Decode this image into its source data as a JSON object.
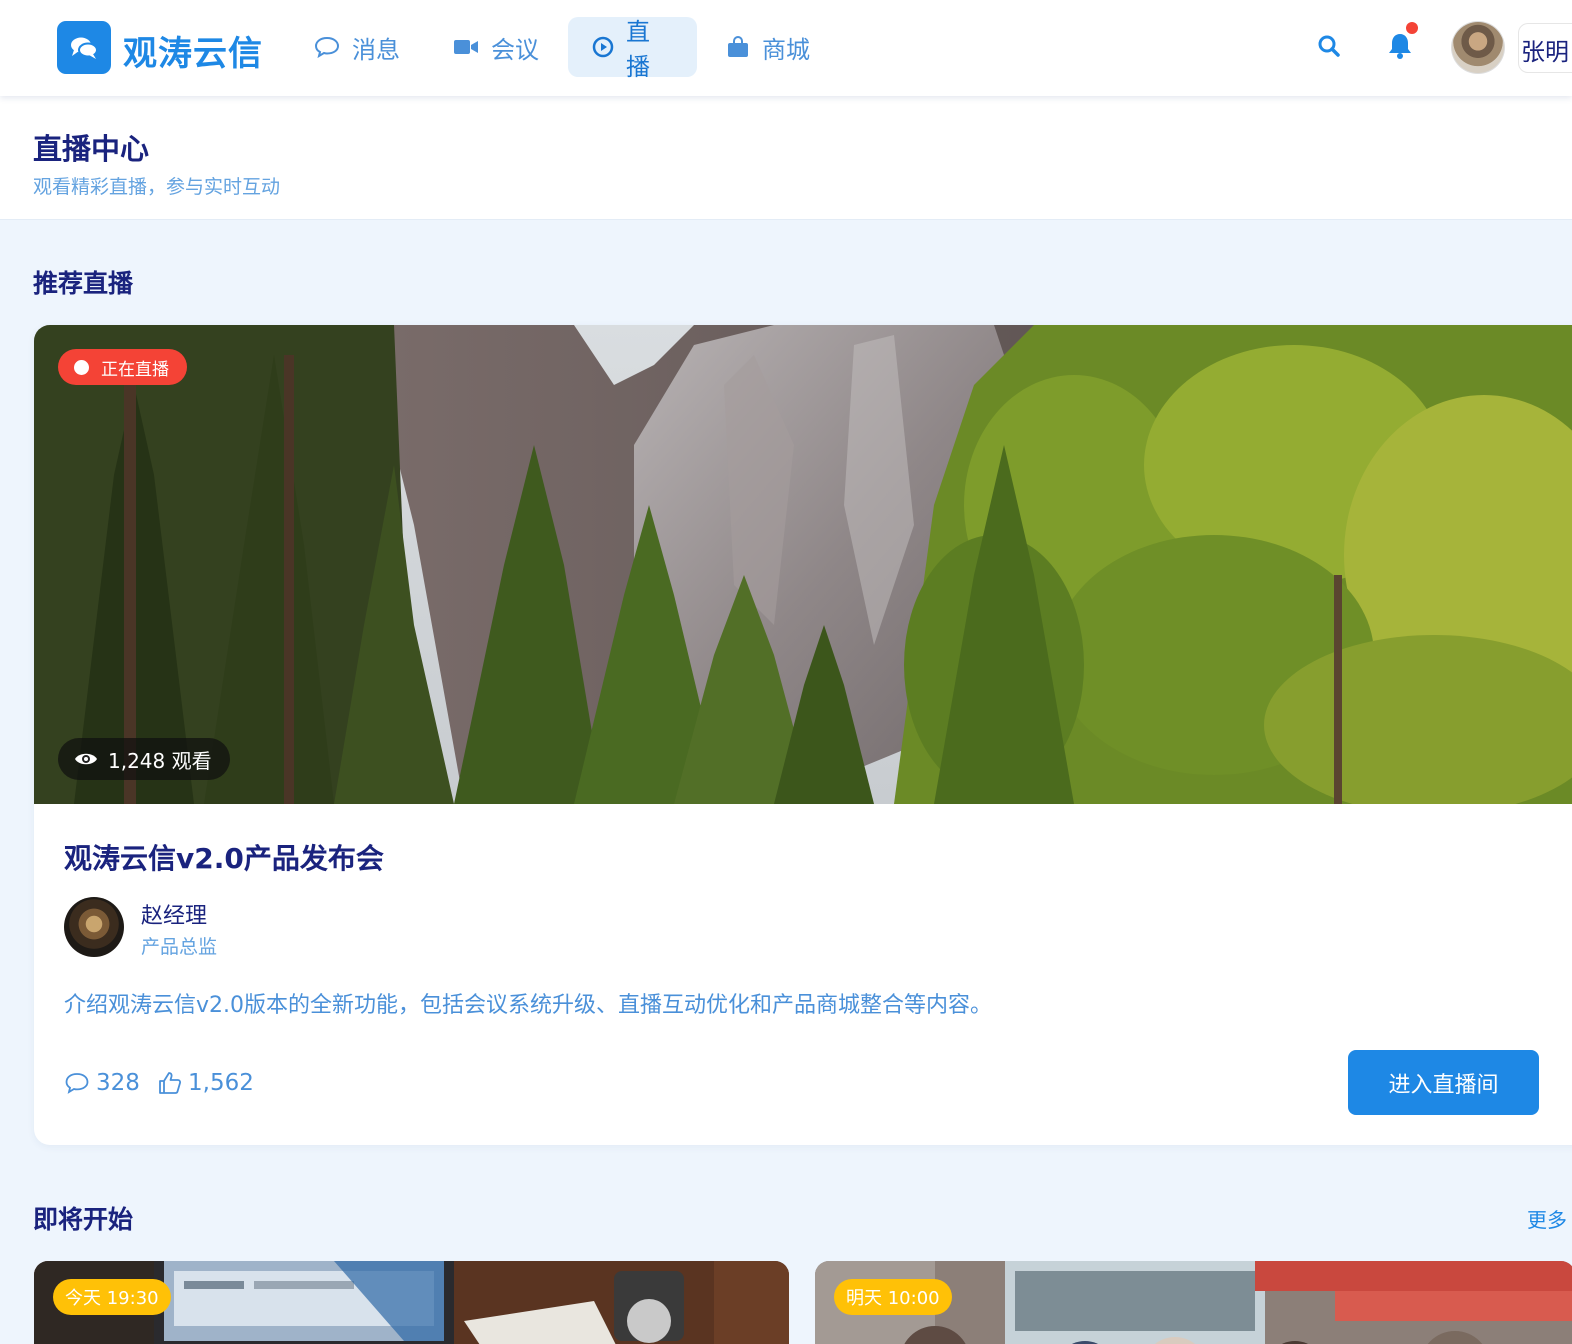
{
  "app": {
    "brand": "观涛云信",
    "nav": [
      {
        "label": "消息",
        "icon": "chat-bubble-icon"
      },
      {
        "label": "会议",
        "icon": "video-camera-icon"
      },
      {
        "label": "直播",
        "icon": "play-circle-icon",
        "active": true
      },
      {
        "label": "商城",
        "icon": "shopping-bag-icon"
      }
    ],
    "user": {
      "name": "张明"
    },
    "has_notification": true
  },
  "header": {
    "title": "直播中心",
    "subtitle": "观看精彩直播，参与实时互动"
  },
  "featured_section": {
    "title": "推荐直播"
  },
  "featured": {
    "status": "正在直播",
    "viewers": "1,248 观看",
    "title": "观涛云信v2.0产品发布会",
    "host_name": "赵经理",
    "host_role": "产品总监",
    "description": "介绍观涛云信v2.0版本的全新功能，包括会议系统升级、直播互动优化和产品商城整合等内容。",
    "comments": "328",
    "likes": "1,562",
    "enter_label": "进入直播间"
  },
  "upcoming_section": {
    "title": "即将开始",
    "more": "更多"
  },
  "upcoming": [
    {
      "time": "今天 19:30"
    },
    {
      "time": "明天 10:00"
    }
  ],
  "colors": {
    "primary": "#1e88e5",
    "navy": "#1a237e",
    "live_red": "#f44336",
    "badge_yellow": "#ffc107",
    "page_bg": "#eef5fd"
  }
}
